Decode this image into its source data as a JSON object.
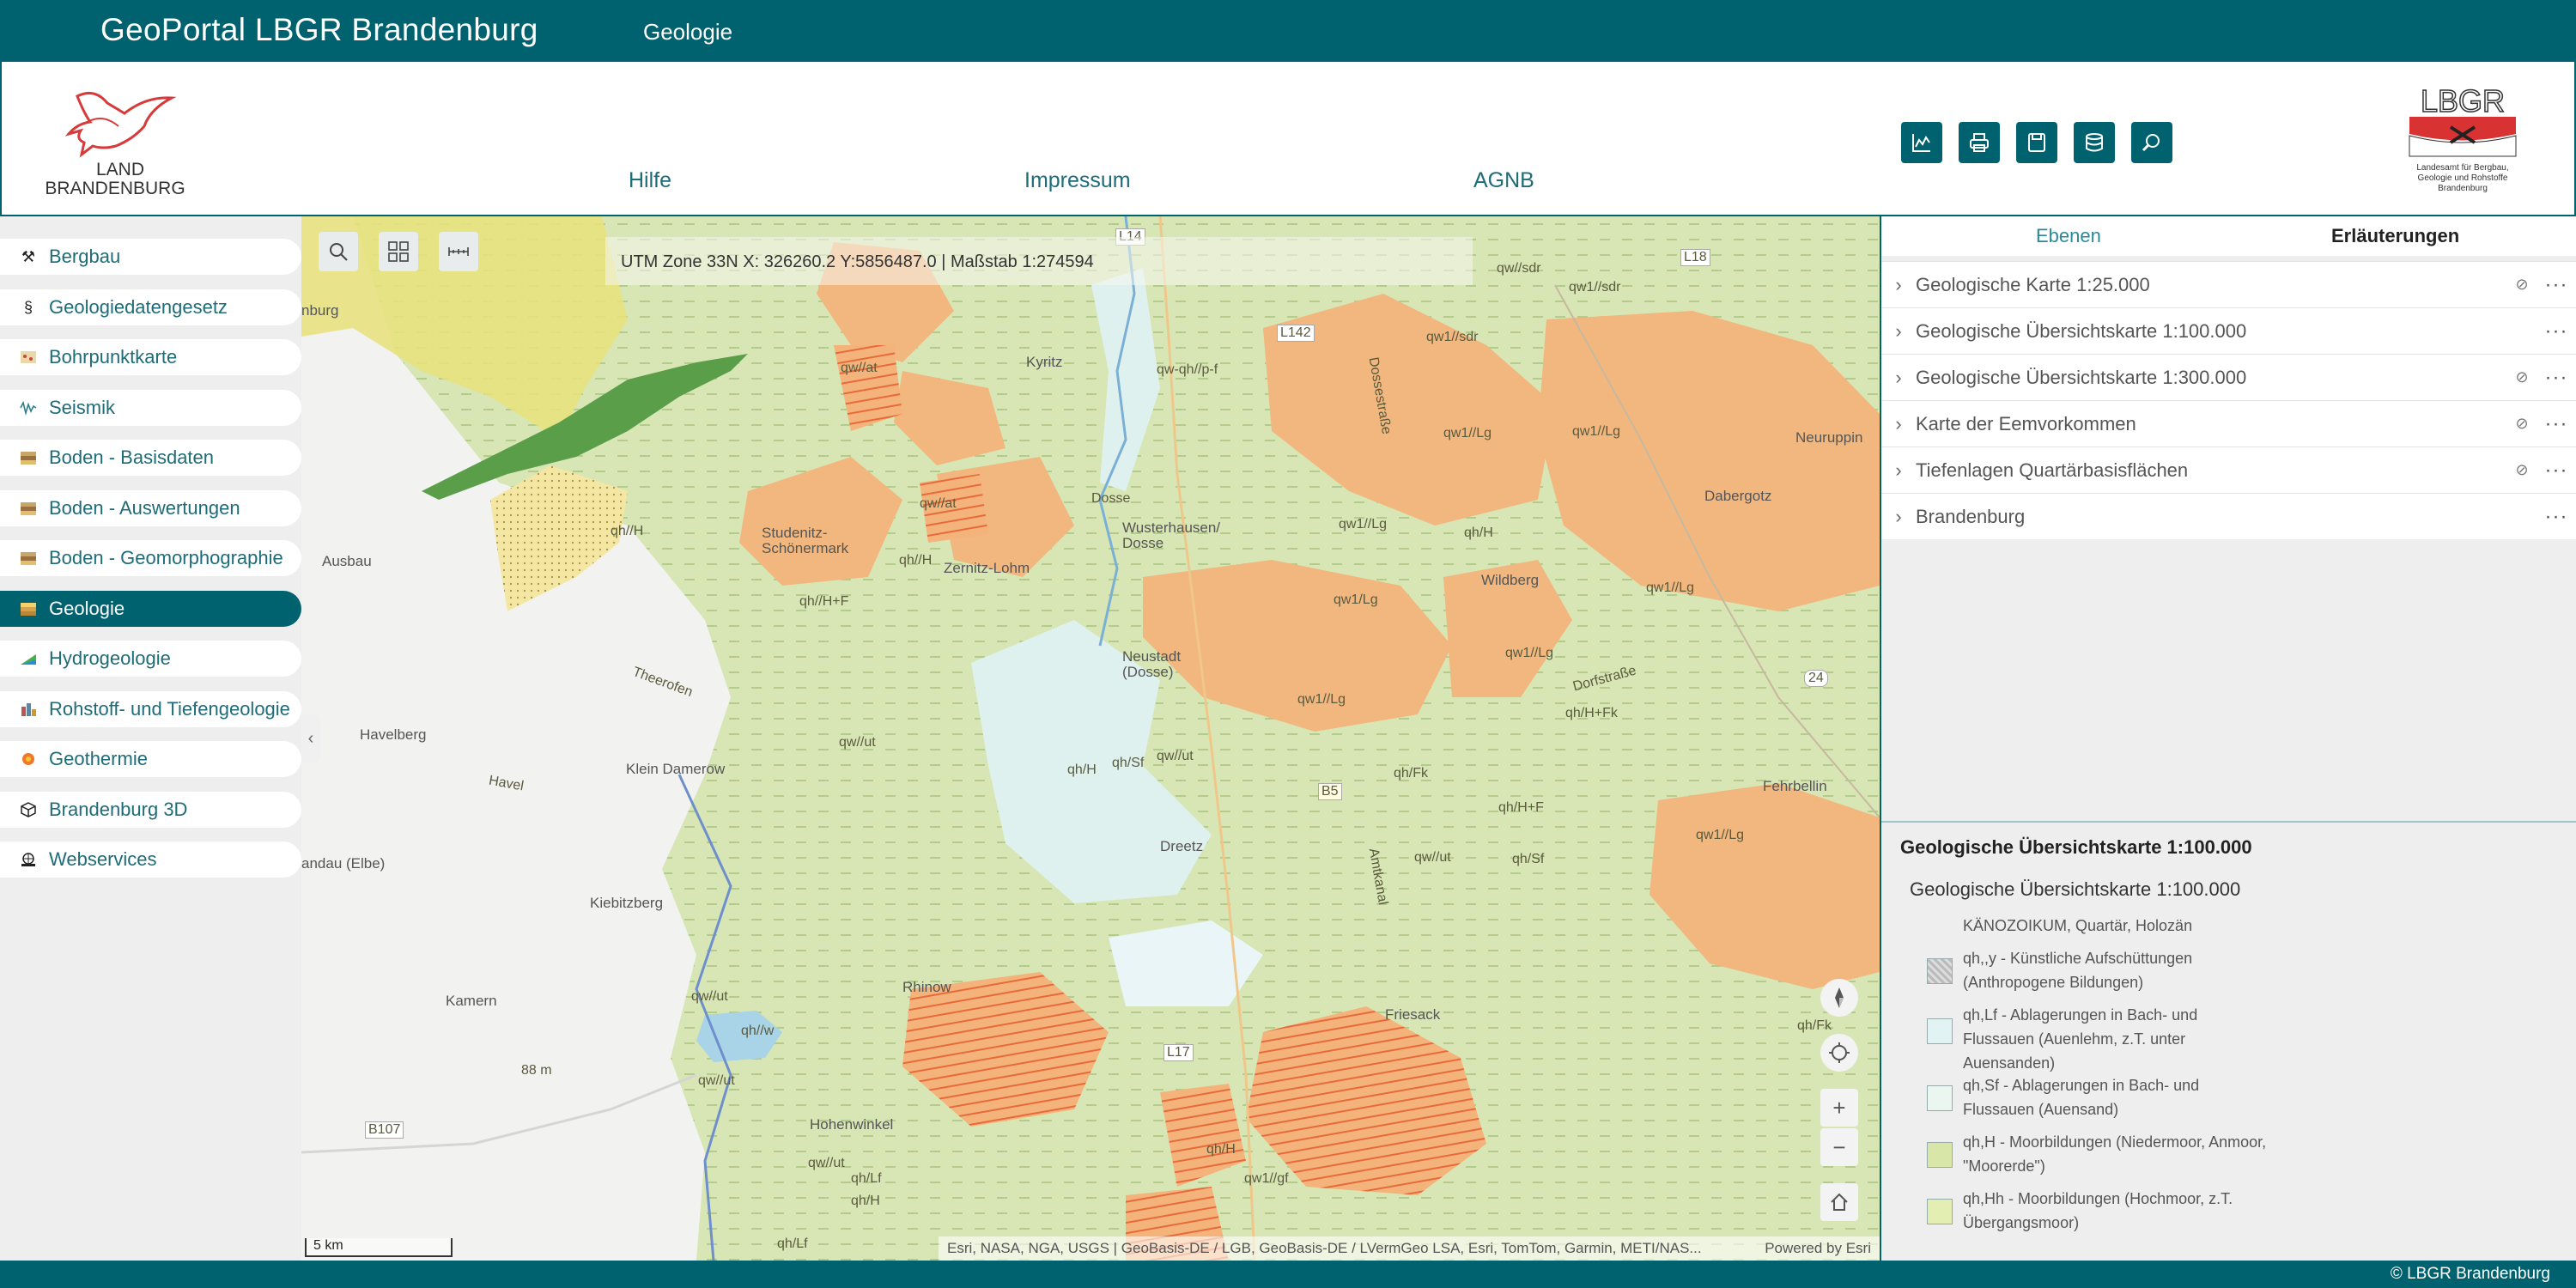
{
  "topbar": {
    "title": "GeoPortal LBGR Brandenburg",
    "section": "Geologie"
  },
  "header": {
    "brand_logo": {
      "line1": "LAND",
      "line2": "BRANDENBURG"
    },
    "links": {
      "hilfe": "Hilfe",
      "impressum": "Impressum",
      "agnb": "AGNB"
    },
    "tools": [
      "chart-icon",
      "print-icon",
      "save-icon",
      "database-icon",
      "search-map-icon"
    ],
    "lbgr_logo": {
      "acronym": "LBGR",
      "line1": "Landesamt für Bergbau,",
      "line2": "Geologie und Rohstoffe",
      "line3": "Brandenburg"
    }
  },
  "sidebar": {
    "items": [
      {
        "label": "Bergbau",
        "icon": "mining-hammer-icon",
        "active": false
      },
      {
        "label": "Geologiedatengesetz",
        "icon": "paragraph-icon",
        "active": false
      },
      {
        "label": "Bohrpunktkarte",
        "icon": "drillpoint-map-icon",
        "active": false
      },
      {
        "label": "Seismik",
        "icon": "seismic-icon",
        "active": false
      },
      {
        "label": "Boden - Basisdaten",
        "icon": "soil-layers-icon",
        "active": false
      },
      {
        "label": "Boden - Auswertungen",
        "icon": "soil-layers-icon",
        "active": false
      },
      {
        "label": "Boden - Geomorphographie",
        "icon": "soil-layers-icon",
        "active": false
      },
      {
        "label": "Geologie",
        "icon": "geology-layers-icon",
        "active": true
      },
      {
        "label": "Hydrogeologie",
        "icon": "hydrogeology-icon",
        "active": false
      },
      {
        "label": "Rohstoff- und Tiefengeologie",
        "icon": "resources-icon",
        "active": false
      },
      {
        "label": "Geothermie",
        "icon": "geothermal-icon",
        "active": false
      },
      {
        "label": "Brandenburg 3D",
        "icon": "cube-3d-icon",
        "active": false
      },
      {
        "label": "Webservices",
        "icon": "webservices-icon",
        "active": false
      }
    ]
  },
  "map": {
    "coord_text": "UTM Zone 33N X: 326260.2 Y:5856487.0 | Maßstab 1:274594",
    "scale_label": "5 km",
    "attribution": "Esri, NASA, NGA, USGS | GeoBasis-DE / LGB, GeoBasis-DE / LVermGeo LSA, Esri, TomTom, Garmin, METI/NAS...",
    "powered_by": "Powered by Esri",
    "road_labels": [
      "L14",
      "L142",
      "L18",
      "24",
      "B5",
      "L17",
      "B107"
    ],
    "town_labels": [
      "Kyritz",
      "Wusterhausen/ Dosse",
      "Studenitz- Schönermark",
      "Zernitz-Lohm",
      "Neustadt (Dosse)",
      "Wildberg",
      "Dabergotz",
      "Neuruppin",
      "Fehrbellin",
      "Dreetz",
      "Havelberg",
      "Klein Damerow",
      "Kiebitzberg",
      "Kamern",
      "Rhinow",
      "Friesack",
      "Hohenwinkel",
      "Ausbau",
      "nburg",
      "andau (Elbe)"
    ],
    "geo_labels": [
      "qw//sdr",
      "qw1//sdr",
      "qw//at",
      "qw-qh//p-f",
      "qw1//Lg",
      "qh//H",
      "qh//H+F",
      "qh//H",
      "qw1//Lg",
      "qh/H",
      "qw1//Lg",
      "qw1/Lg",
      "qh/H+Fk",
      "qw//ut",
      "qh/H",
      "qh/Sf",
      "qw//ut",
      "qh/Fk",
      "qh/H+F",
      "qw1//Lg",
      "qw//ut",
      "qh/Sf",
      "qw//ut",
      "qh//w",
      "qw//ut",
      "qw//ut",
      "qh/Lf",
      "qh/H",
      "qh/Fk",
      "qw1//gf",
      "qh/H",
      "qh/Lf",
      "Amtkanal",
      "Theerofen",
      "Dossestraße",
      "Dorfstraße",
      "Havel",
      "Dosse",
      "88 m"
    ],
    "controls": [
      "compass-icon",
      "locate-icon",
      "zoom-in-icon",
      "zoom-out-icon",
      "home-icon"
    ]
  },
  "rightpanel": {
    "tabs": {
      "ebenen": "Ebenen",
      "erlaeuterungen": "Erläuterungen"
    },
    "layers": [
      {
        "name": "Geologische Karte 1:25.000",
        "hidden": true
      },
      {
        "name": "Geologische Übersichtskarte 1:100.000",
        "hidden": false
      },
      {
        "name": "Geologische Übersichtskarte 1:300.000",
        "hidden": true
      },
      {
        "name": "Karte der Eemvorkommen",
        "hidden": true
      },
      {
        "name": "Tiefenlagen Quartärbasisflächen",
        "hidden": true
      },
      {
        "name": "Brandenburg",
        "hidden": false
      }
    ],
    "legend": {
      "title": "Geologische Übersichtskarte 1:100.000",
      "subtitle": "Geologische Übersichtskarte 1:100.000",
      "header_entry": "KÄNOZOIKUM, Quartär, Holozän",
      "entries": [
        {
          "label": "qh,,y - Künstliche Aufschüttungen (Anthropogene Bildungen)",
          "color": "#c8c8c8"
        },
        {
          "label": "qh,Lf - Ablagerungen in Bach- und Flussauen (Auenlehm, z.T. unter Auensanden)",
          "color": "#e2f3f3"
        },
        {
          "label": "qh,Sf - Ablagerungen in Bach- und Flussauen (Auensand)",
          "color": "#eaf7f1"
        },
        {
          "label": "qh,H - Moorbildungen (Niedermoor, Anmoor, \"Moorerde\")",
          "color": "#d8e7a8"
        },
        {
          "label": "qh,Hh - Moorbildungen (Hochmoor, z.T. Übergangsmoor)",
          "color": "#e3eeb2"
        }
      ]
    }
  },
  "footer": {
    "copyright": "© LBGR Brandenburg"
  },
  "colors": {
    "primary": "#00626f",
    "accent_text": "#1d6c78"
  }
}
